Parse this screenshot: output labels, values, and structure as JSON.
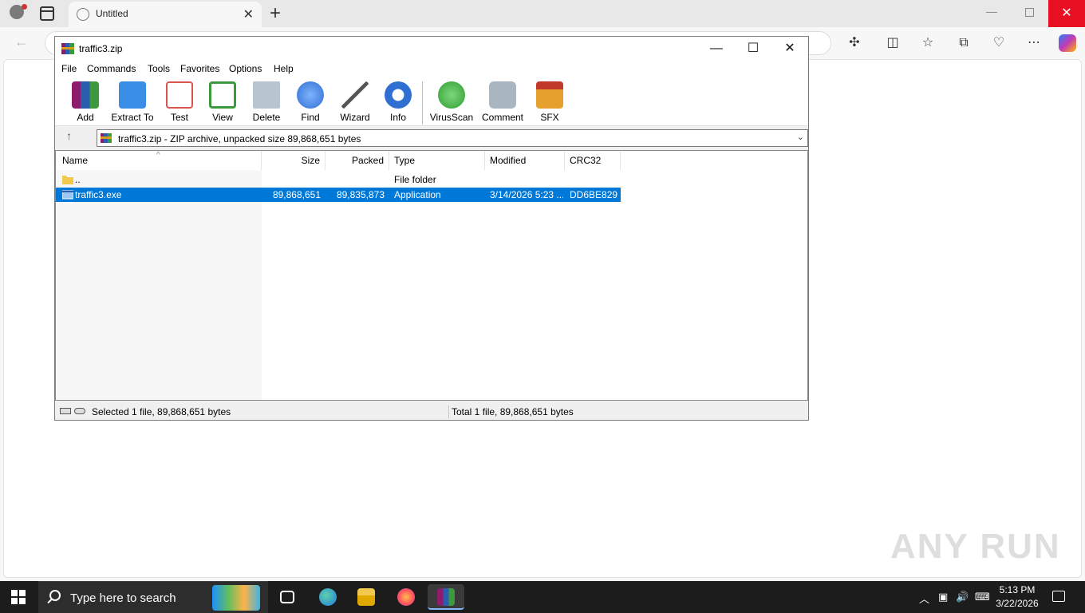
{
  "browser": {
    "tab_title": "Untitled",
    "new_tab_icon": "plus-icon",
    "close_tab_icon": "close-icon"
  },
  "winrar": {
    "title": "traffic3.zip",
    "menu": [
      "File",
      "Commands",
      "Tools",
      "Favorites",
      "Options",
      "Help"
    ],
    "toolbar": [
      {
        "label": "Add",
        "icon": "add-archive-icon",
        "color": "#c0392b"
      },
      {
        "label": "Extract To",
        "icon": "extract-folder-icon",
        "color": "#3a8ee6"
      },
      {
        "label": "Test",
        "icon": "test-checklist-icon",
        "color": "#d9534f"
      },
      {
        "label": "View",
        "icon": "view-book-icon",
        "color": "#3c9a3c"
      },
      {
        "label": "Delete",
        "icon": "trash-icon",
        "color": "#8a9aa8"
      },
      {
        "label": "Find",
        "icon": "magnifier-icon",
        "color": "#2e6fd1"
      },
      {
        "label": "Wizard",
        "icon": "magic-wand-icon",
        "color": "#7a7a7a"
      },
      {
        "label": "Info",
        "icon": "info-icon",
        "color": "#2e6fd1"
      },
      {
        "label": "VirusScan",
        "icon": "virus-scan-icon",
        "color": "#2f9e2f"
      },
      {
        "label": "Comment",
        "icon": "comment-icon",
        "color": "#8a9aa8"
      },
      {
        "label": "SFX",
        "icon": "sfx-box-icon",
        "color": "#e5a02d"
      }
    ],
    "path_text": "traffic3.zip - ZIP archive, unpacked size 89,868,651 bytes",
    "columns": [
      "Name",
      "Size",
      "Packed",
      "Type",
      "Modified",
      "CRC32"
    ],
    "rows": [
      {
        "name": "..",
        "size": "",
        "packed": "",
        "type": "File folder",
        "modified": "",
        "crc": "",
        "selected": false
      },
      {
        "name": "traffic3.exe",
        "size": "89,868,651",
        "packed": "89,835,873",
        "type": "Application",
        "modified": "3/14/2026 5:23 ...",
        "crc": "DD6BE829",
        "selected": true
      }
    ],
    "status_left": "Selected 1 file, 89,868,651 bytes",
    "status_right": "Total 1 file, 89,868,651 bytes"
  },
  "watermark": "ANY RUN",
  "taskbar": {
    "search_placeholder": "Type here to search",
    "time": "5:13 PM",
    "date": "3/22/2026"
  }
}
